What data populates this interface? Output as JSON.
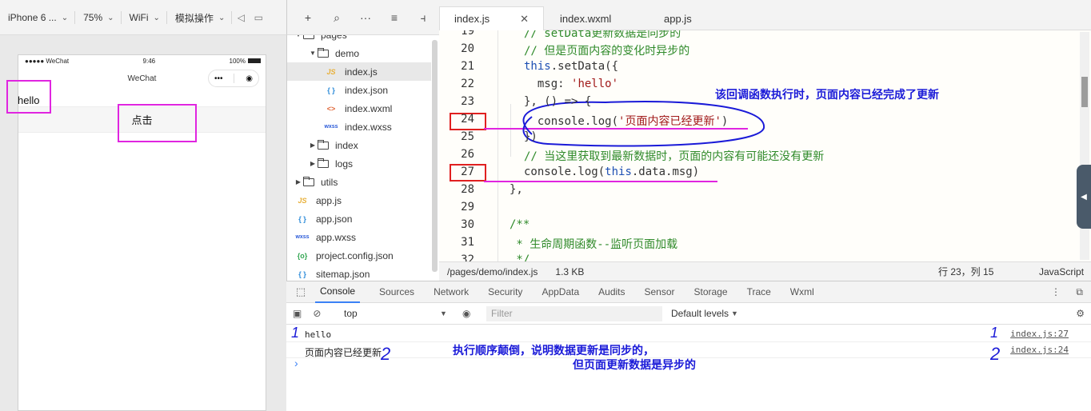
{
  "simulator": {
    "toolbar": {
      "device": "iPhone 6 ...",
      "zoom": "75%",
      "network": "WiFi",
      "mode": "模拟操作"
    },
    "status": {
      "carrier": "●●●●● WeChat",
      "time": "9:46",
      "battery": "100%"
    },
    "nav_title": "WeChat",
    "page_text": "hello",
    "button_label": "点击"
  },
  "explorer": {
    "items": [
      {
        "label": "pages",
        "type": "folder",
        "depth": 0,
        "open": true
      },
      {
        "label": "demo",
        "type": "folder",
        "depth": 1,
        "open": true
      },
      {
        "label": "index.js",
        "type": "js",
        "depth": 2,
        "selected": true
      },
      {
        "label": "index.json",
        "type": "json",
        "depth": 2
      },
      {
        "label": "index.wxml",
        "type": "wxml",
        "depth": 2
      },
      {
        "label": "index.wxss",
        "type": "wxss",
        "depth": 2
      },
      {
        "label": "index",
        "type": "folder",
        "depth": 1,
        "open": false
      },
      {
        "label": "logs",
        "type": "folder",
        "depth": 1,
        "open": false
      },
      {
        "label": "utils",
        "type": "folder",
        "depth": 0,
        "open": false
      },
      {
        "label": "app.js",
        "type": "js",
        "depth": 0
      },
      {
        "label": "app.json",
        "type": "json",
        "depth": 0
      },
      {
        "label": "app.wxss",
        "type": "wxss",
        "depth": 0
      },
      {
        "label": "project.config.json",
        "type": "cfg",
        "depth": 0
      },
      {
        "label": "sitemap.json",
        "type": "json",
        "depth": 0
      }
    ]
  },
  "editor": {
    "tabs": [
      "index.js",
      "index.wxml",
      "app.js"
    ],
    "line_numbers": [
      "19",
      "20",
      "21",
      "22",
      "23",
      "24",
      "25",
      "26",
      "27",
      "28",
      "29",
      "30",
      "31",
      "32"
    ],
    "lines": [
      [
        [
          "c-cm",
          "// setData更新数据是同步的"
        ]
      ],
      [
        [
          "c-cm",
          "// 但是页面内容的变化时异步的"
        ]
      ],
      [
        [
          "c-kw",
          "this"
        ],
        [
          "",
          ".setData({"
        ]
      ],
      [
        [
          "",
          "  msg: "
        ],
        [
          "c-str",
          "'hello'"
        ]
      ],
      [
        [
          "",
          "}, () => {"
        ]
      ],
      [
        [
          "",
          "  console.log("
        ],
        [
          "c-str",
          "'页面内容已经更新'"
        ],
        [
          "",
          ")"
        ]
      ],
      [
        [
          "",
          "})"
        ]
      ],
      [
        [
          "c-cm",
          "// 当这里获取到最新数据时，页面的内容有可能还没有更新"
        ]
      ],
      [
        [
          "",
          "console.log("
        ],
        [
          "c-kw",
          "this"
        ],
        [
          "",
          ".data.msg)"
        ]
      ],
      [
        [
          "",
          "},"
        ]
      ],
      [
        [
          "",
          ""
        ]
      ],
      [
        [
          "c-cm",
          "/**"
        ]
      ],
      [
        [
          "c-cm",
          " * 生命周期函数--监听页面加载"
        ]
      ],
      [
        [
          "c-cm",
          " */"
        ]
      ]
    ],
    "annotation": "该回调函数执行时，页面内容已经完成了更新"
  },
  "editor_status": {
    "path": "/pages/demo/index.js",
    "size": "1.3 KB",
    "position": "行 23，列 15",
    "language": "JavaScript"
  },
  "devtools": {
    "tabs": [
      "Console",
      "Sources",
      "Network",
      "Security",
      "AppData",
      "Audits",
      "Sensor",
      "Storage",
      "Trace",
      "Wxml"
    ],
    "context": "top",
    "filter_placeholder": "Filter",
    "levels": "Default levels",
    "logs": [
      {
        "message": "hello",
        "source": "index.js:27"
      },
      {
        "message": "页面内容已经更新",
        "source": "index.js:24"
      }
    ],
    "prompt": "›",
    "annotation_line1": "执行顺序颠倒，说明数据更新是同步的，",
    "annotation_line2": "但页面更新数据是异步的",
    "handwritten": {
      "a": "1",
      "b": "2",
      "c": "1",
      "d": "2"
    }
  },
  "colors": {
    "annotation": "#1a1ad8",
    "highlight_box": "#e025e0",
    "red_box": "#e02020",
    "accent": "#3b82f6"
  }
}
